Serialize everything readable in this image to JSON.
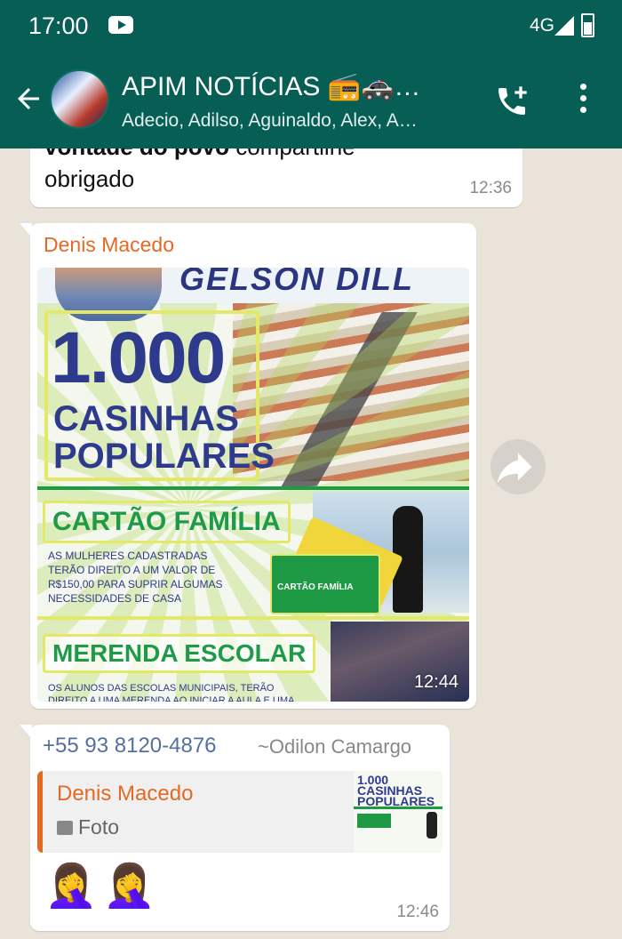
{
  "status_bar": {
    "time": "17:00",
    "network": "4G",
    "notification_icon": "youtube-icon"
  },
  "header": {
    "title": "APIM NOTÍCIAS 📻🚓…",
    "subtitle": "Adecio, Adilso, Aguinaldo, Alex, A…"
  },
  "messages": [
    {
      "type": "text",
      "text_bold": "vontade do povo",
      "text_rest": " compartilhe",
      "text_line2": "obrigado",
      "time": "12:36"
    },
    {
      "type": "image",
      "sender": "Denis Macedo",
      "time": "12:44",
      "poster": {
        "header": "GELSON DILL",
        "big_number": "1.000",
        "line1": "CASINHAS",
        "line2": "POPULARES",
        "card_title": "CARTÃO FAMÍLIA",
        "card_text": "AS MULHERES CADASTRADAS TERÃO DIREITO A UM VALOR DE R$150,00 PARA SUPRIR ALGUMAS NECESSIDADES DE CASA",
        "card_label": "CARTÃO FAMÍLIA",
        "meal_title": "MERENDA ESCOLAR",
        "meal_text": "OS ALUNOS DAS ESCOLAS MUNICIPAIS, TERÃO DIREITO A UMA MERENDA AO INICIAR A AULA E UMA REFEIÇÃO NUTRITIVA"
      }
    },
    {
      "type": "reply",
      "phone": "+55 93 8120-4876",
      "push_name": "~Odilon Camargo",
      "quoted_sender": "Denis Macedo",
      "quoted_type": "Foto",
      "quoted_thumb_text": "1.000 CASINHAS POPULARES",
      "emojis": "🤦‍♀️🤦‍♀️",
      "time": "12:46"
    }
  ],
  "colors": {
    "header_bg": "#075e54",
    "chat_bg": "#e9e3da",
    "sender_name": "#e36a24",
    "phone": "#55709e"
  }
}
